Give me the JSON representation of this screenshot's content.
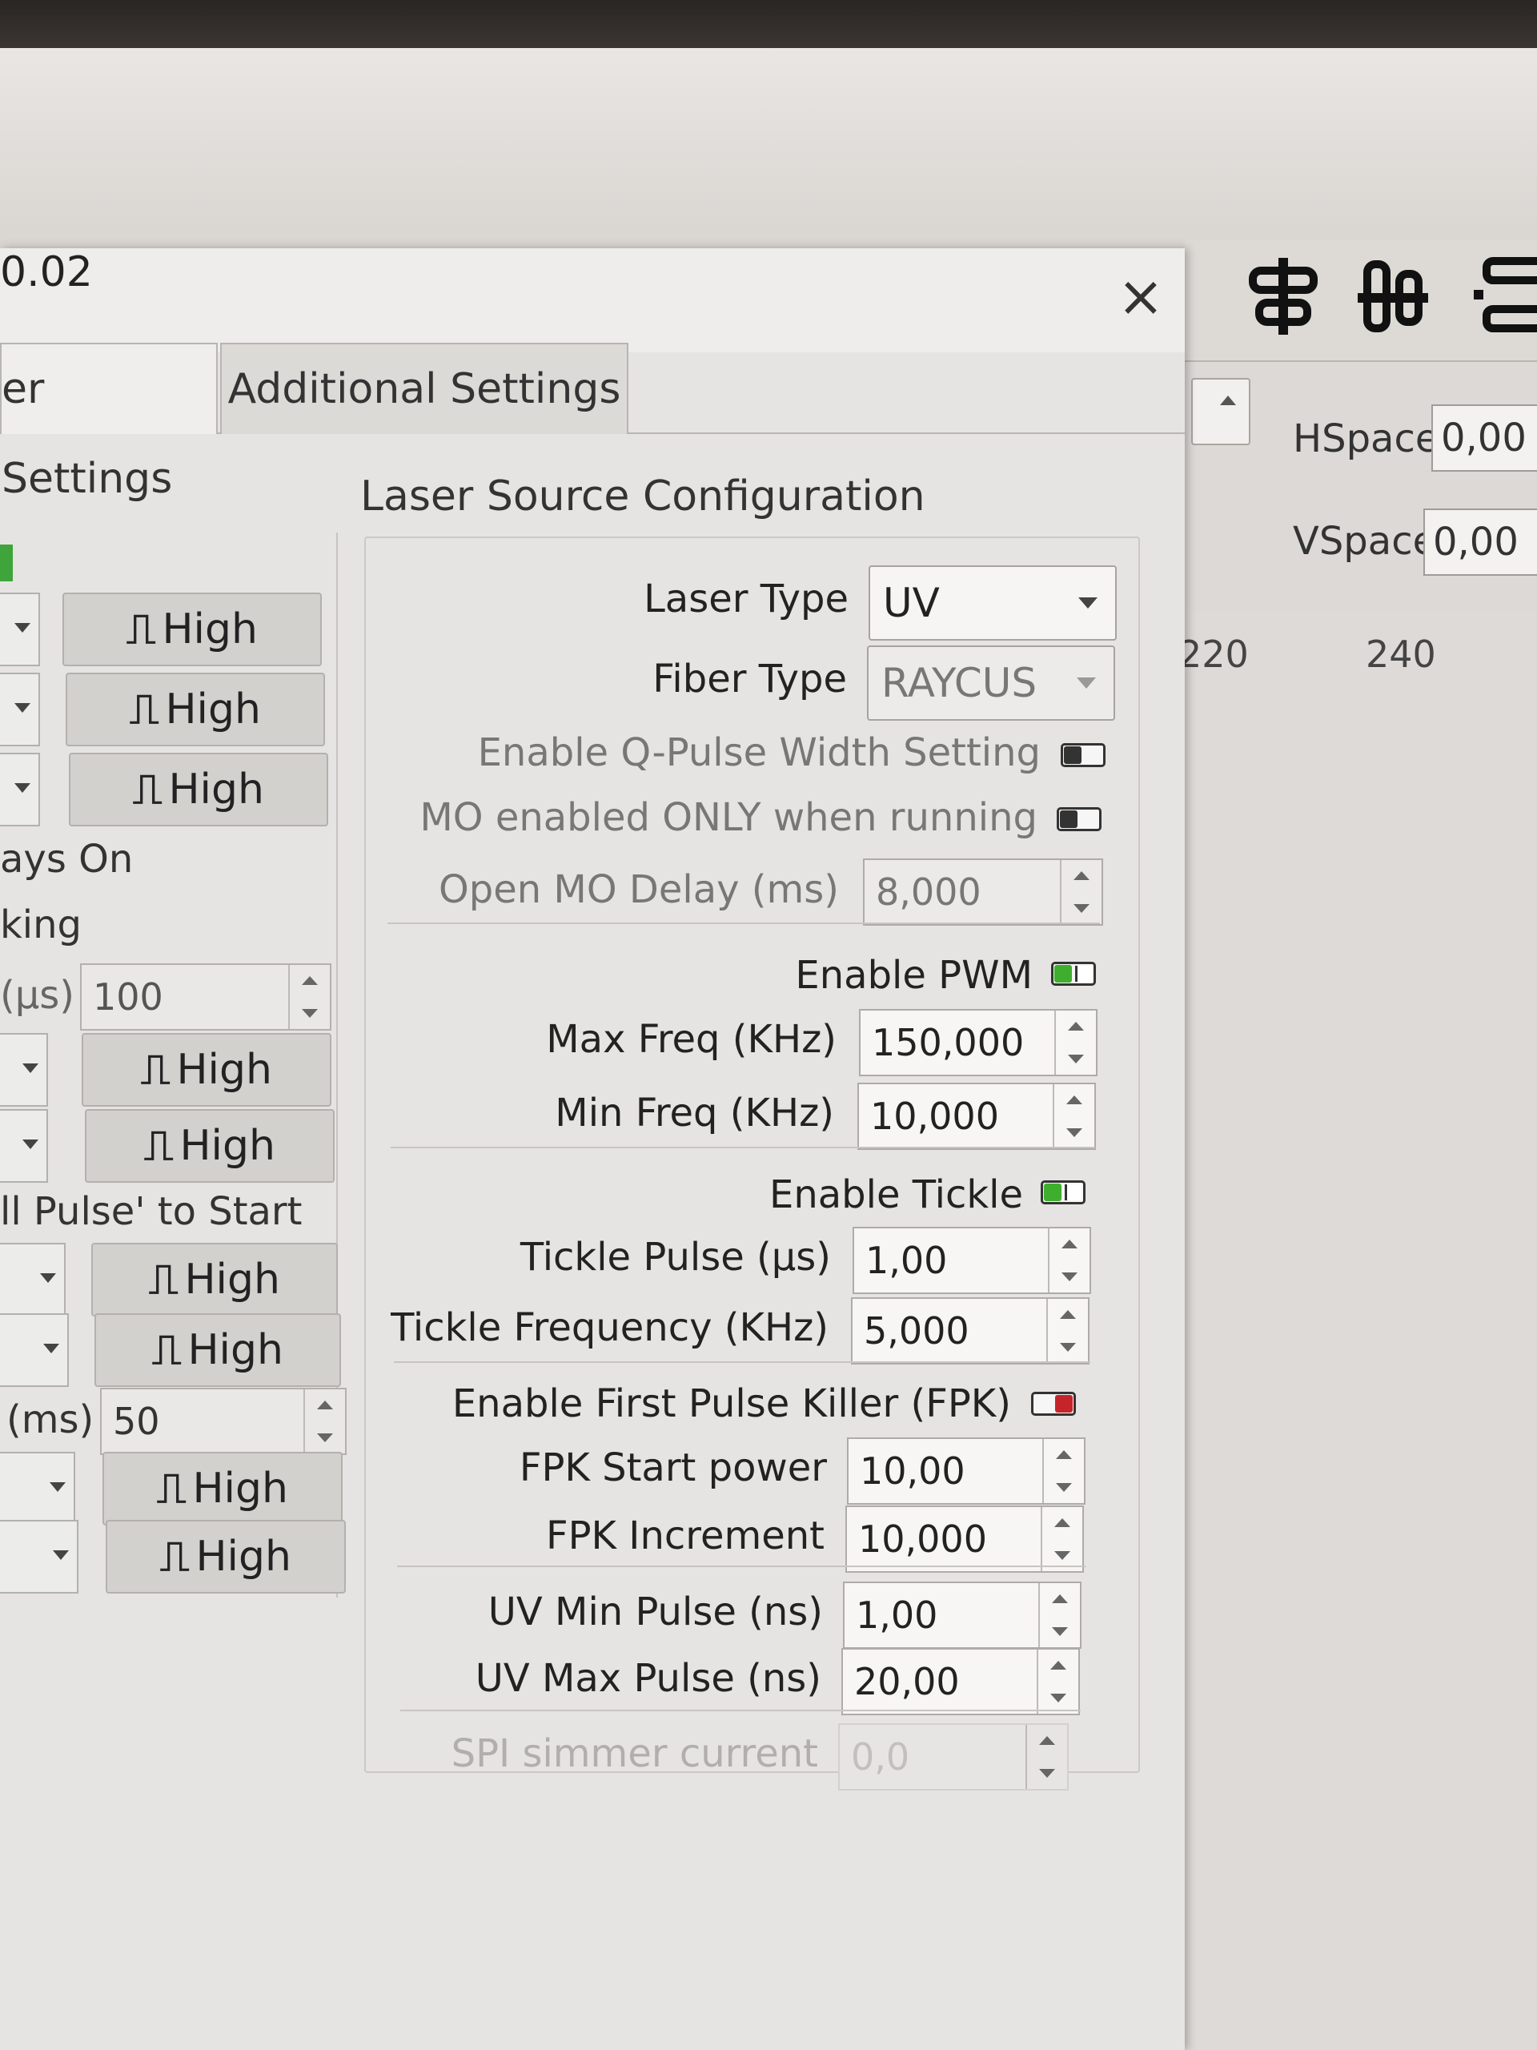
{
  "dialog": {
    "title": "0.02",
    "close_label": "×",
    "tabs": [
      {
        "label": "er Settings",
        "active": true
      },
      {
        "label": "Additional Settings",
        "active": false
      }
    ]
  },
  "background_app": {
    "hspace_label": "HSpace",
    "hspace_value": "0,00",
    "vspace_label": "VSpace",
    "vspace_value": "0,00",
    "ruler": [
      "220",
      "240"
    ],
    "toolbar_icons": [
      "align-horizontal-icon",
      "align-vertical-icon",
      "distribute-icon"
    ]
  },
  "left_column": {
    "pulse_glyph": "⎍",
    "rows": [
      {
        "button": "High"
      },
      {
        "button": "High"
      },
      {
        "button": "High"
      },
      {
        "text": "ays On"
      },
      {
        "text": "king"
      },
      {
        "label": "(µs)",
        "value": "100"
      },
      {
        "button": "High"
      },
      {
        "button": "High"
      },
      {
        "text": "ll Pulse' to Start"
      },
      {
        "button": "High"
      },
      {
        "button": "High"
      },
      {
        "label": "(ms)",
        "value": "50"
      },
      {
        "button": "High"
      },
      {
        "button": "High"
      }
    ]
  },
  "laser_config": {
    "title": "Laser Source Configuration",
    "laser_type": {
      "label": "Laser Type",
      "value": "UV"
    },
    "fiber_type": {
      "label": "Fiber Type",
      "value": "RAYCUS"
    },
    "q_pulse": {
      "label": "Enable Q-Pulse Width Setting",
      "state": "off"
    },
    "mo_enabled": {
      "label": "MO enabled ONLY when running",
      "state": "off"
    },
    "open_mo_delay": {
      "label": "Open MO Delay (ms)",
      "value": "8,000"
    },
    "enable_pwm": {
      "label": "Enable PWM",
      "state": "on"
    },
    "max_freq": {
      "label": "Max Freq (KHz)",
      "value": "150,000"
    },
    "min_freq": {
      "label": "Min Freq (KHz)",
      "value": "10,000"
    },
    "enable_tickle": {
      "label": "Enable Tickle",
      "state": "on"
    },
    "tickle_pulse": {
      "label": "Tickle Pulse (µs)",
      "value": "1,00"
    },
    "tickle_freq": {
      "label": "Tickle Frequency (KHz)",
      "value": "5,000"
    },
    "enable_fpk": {
      "label": "Enable First Pulse Killer (FPK)",
      "state": "off-red"
    },
    "fpk_start": {
      "label": "FPK Start power",
      "value": "10,00"
    },
    "fpk_increment": {
      "label": "FPK Increment",
      "value": "10,000"
    },
    "uv_min_pulse": {
      "label": "UV Min Pulse (ns)",
      "value": "1,00"
    },
    "uv_max_pulse": {
      "label": "UV Max Pulse (ns)",
      "value": "20,00"
    },
    "spi_simmer": {
      "label": "SPI simmer current",
      "value": "0,0"
    }
  },
  "colors": {
    "toggle_on": "#3fae2f",
    "toggle_red": "#c6242b",
    "dialog_bg": "#e6e4e2"
  }
}
